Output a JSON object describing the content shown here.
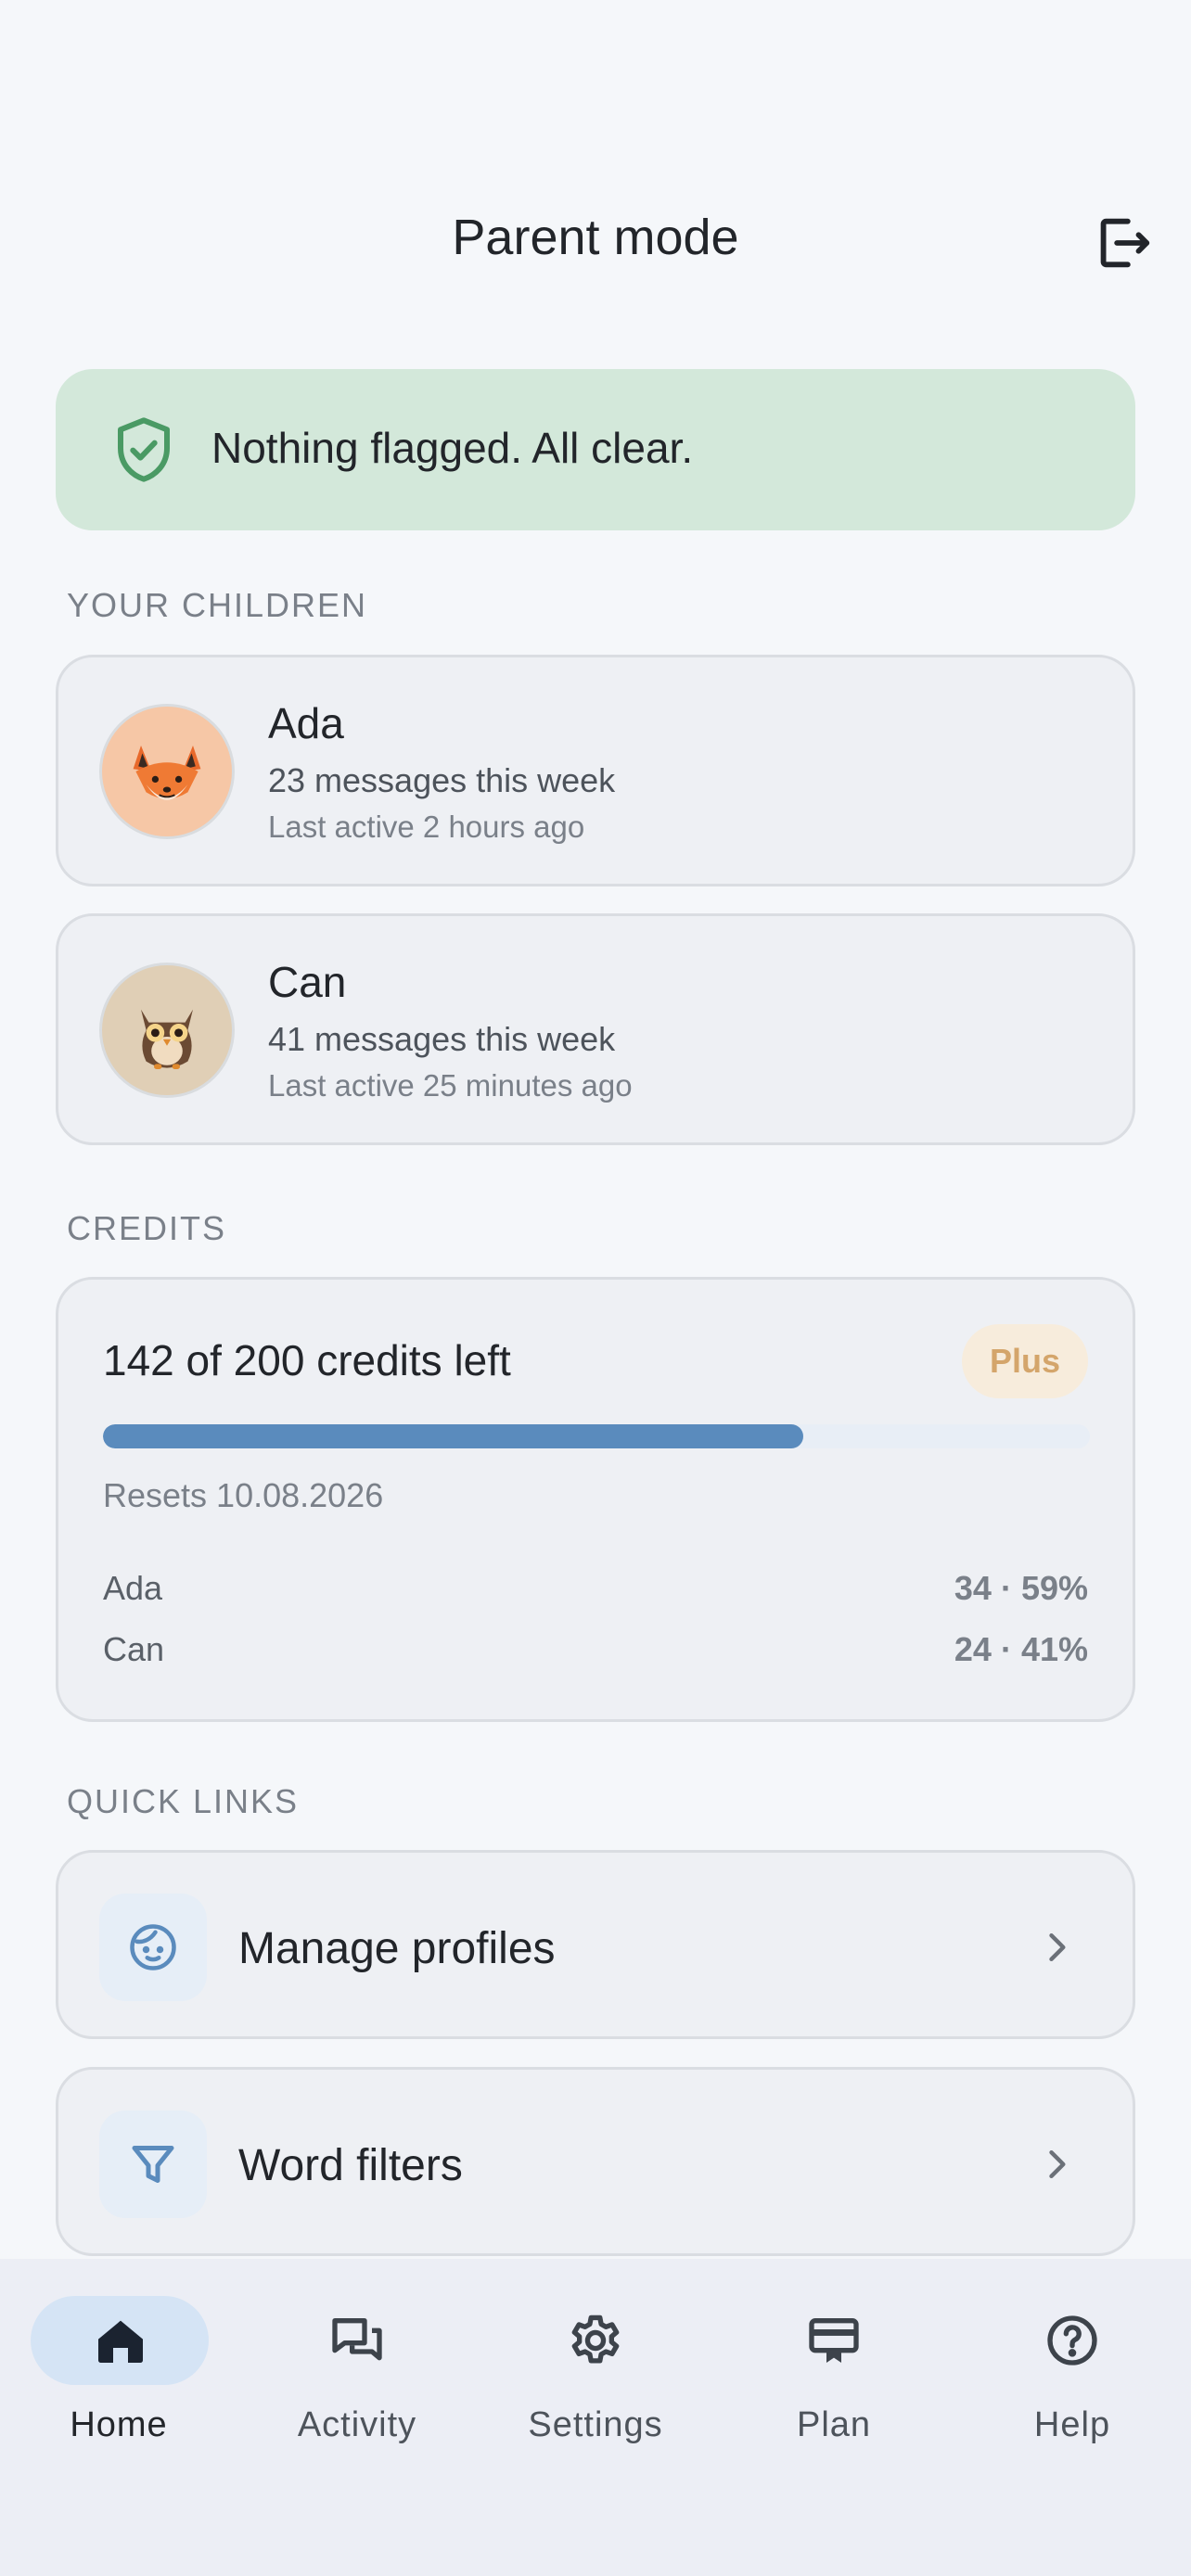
{
  "header": {
    "title": "Parent mode"
  },
  "banner": {
    "text": "Nothing flagged. All clear."
  },
  "children_section": {
    "label": "YOUR CHILDREN",
    "children": [
      {
        "name": "Ada",
        "messages": "23 messages this week",
        "last_active": "Last active 2 hours ago",
        "avatar": "fox-icon"
      },
      {
        "name": "Can",
        "messages": "41 messages this week",
        "last_active": "Last active 25 minutes ago",
        "avatar": "owl-icon"
      }
    ]
  },
  "credits_section": {
    "label": "CREDITS",
    "title": "142 of 200 credits left",
    "plan": "Plus",
    "used_fraction": 0.71,
    "resets": "Resets 10.08.2026",
    "usage": [
      {
        "name": "Ada",
        "value": "34 · 59%"
      },
      {
        "name": "Can",
        "value": "24 · 41%"
      }
    ]
  },
  "quick_links": {
    "label": "QUICK LINKS",
    "items": [
      {
        "label": "Manage profiles",
        "icon": "face-icon"
      },
      {
        "label": "Word filters",
        "icon": "filter-icon"
      }
    ]
  },
  "nav": {
    "items": [
      {
        "label": "Home",
        "icon": "home-icon",
        "active": true
      },
      {
        "label": "Activity",
        "icon": "chat-icon",
        "active": false
      },
      {
        "label": "Settings",
        "icon": "gear-icon",
        "active": false
      },
      {
        "label": "Plan",
        "icon": "card-icon",
        "active": false
      },
      {
        "label": "Help",
        "icon": "help-icon",
        "active": false
      }
    ]
  },
  "colors": {
    "accent": "#5a8bbd",
    "banner_bg": "#d3e8da",
    "shield": "#4a9a64",
    "plan_badge": "#d4a56b"
  }
}
